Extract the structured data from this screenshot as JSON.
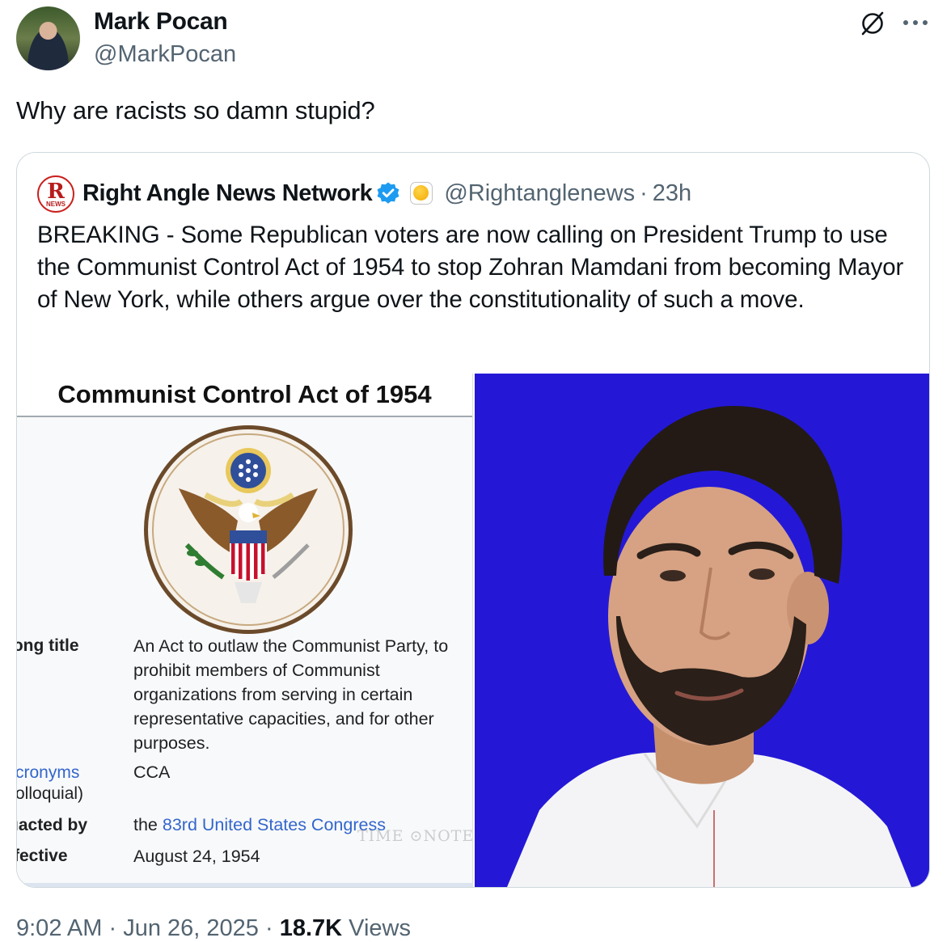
{
  "author": {
    "name": "Mark Pocan",
    "handle": "@MarkPocan",
    "avatar_icon": "avatar-photo"
  },
  "tweet": {
    "text": "Why are racists so damn stupid?"
  },
  "header_icons": [
    "grok-icon",
    "more-icon"
  ],
  "quote": {
    "logo_letter": "R",
    "logo_small": "NEWS",
    "name": "Right Angle News Network",
    "verified_icon": "verified-badge-icon",
    "affiliate_icon": "affiliate-badge-icon",
    "handle": "@Rightanglenews",
    "separator": "·",
    "time": "23h",
    "text": "BREAKING - Some Republican voters are now calling on President Trump to use the Communist Control Act of 1954 to stop Zohran Mamdani from becoming Mayor of New York, while others argue over the constitutionality of such a move."
  },
  "infobox": {
    "title": "Communist Control Act of 1954",
    "seal_icon": "great-seal-icon",
    "rows": [
      {
        "label": "ɔng title",
        "value": "An Act to outlaw the Communist Party, to prohibit members of Communist organizations from serving in certain representative capacities, and for other purposes."
      },
      {
        "label": "cronyms",
        "label2": "olloquial)",
        "value": "CCA"
      },
      {
        "label": "ıacted by",
        "value_prefix": "the ",
        "value_link": "83rd United States Congress"
      },
      {
        "label": "fective",
        "value": "August 24, 1954"
      }
    ],
    "watermark": "TIME ⊙NOTE"
  },
  "footer": {
    "time": "9:02 AM",
    "sep1": "·",
    "date": "Jun 26, 2025",
    "sep2": "·",
    "views_count": "18.7K",
    "views_label": "Views"
  },
  "colors": {
    "text": "#0f1419",
    "muted": "#536471",
    "verified": "#1d9bf0",
    "link": "#3366cc",
    "photo_bg": "#2418d6"
  }
}
